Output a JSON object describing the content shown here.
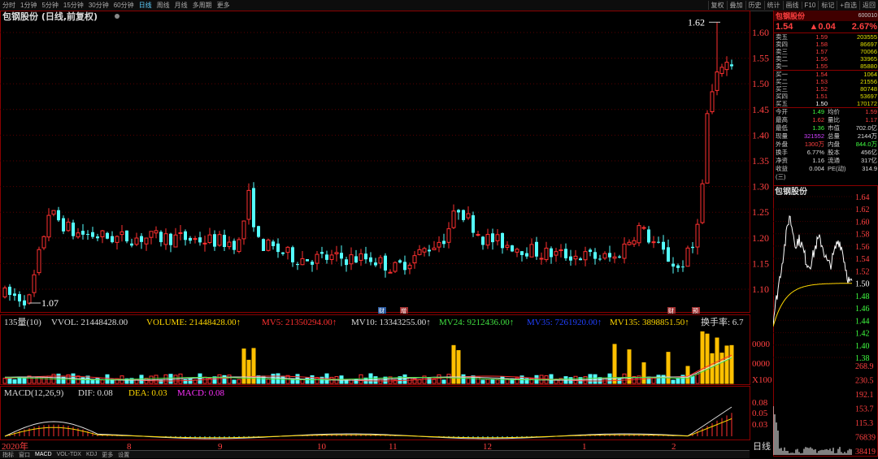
{
  "toolbar": {
    "timeframes": [
      "分时",
      "1分钟",
      "5分钟",
      "15分钟",
      "30分钟",
      "60分钟",
      "日线",
      "周线",
      "月线",
      "多周期",
      "更多"
    ],
    "active_timeframe": "日线",
    "right_buttons": [
      "复权",
      "叠加",
      "历史",
      "统计",
      "画线",
      "F10",
      "标记",
      "+自选",
      "返回"
    ]
  },
  "chart_data": {
    "type": "candlestick",
    "title": "包钢股份 (日线,前复权)",
    "y_ticks": [
      "1.60",
      "1.55",
      "1.50",
      "1.45",
      "1.40",
      "1.35",
      "1.30",
      "1.25",
      "1.20",
      "1.15",
      "1.10"
    ],
    "ylim": [
      1.07,
      1.63
    ],
    "annotation_high": "1.62",
    "annotation_low": "1.07",
    "x_labels": [
      "2020年",
      "8",
      "9",
      "10",
      "11",
      "12",
      "1",
      "2"
    ],
    "vol_legend": [
      {
        "text": "135量(10)",
        "color": "#dddddd"
      },
      {
        "text": "VVOL: 21448428.00",
        "color": "#dddddd"
      },
      {
        "text": "VOLUME: 21448428.00↑",
        "color": "#ffd700"
      },
      {
        "text": "MV5: 21350294.00↑",
        "color": "#ff3030"
      },
      {
        "text": "MV10: 13343255.00↑",
        "color": "#dddddd"
      },
      {
        "text": "MV24: 9212436.00↑",
        "color": "#40e040"
      },
      {
        "text": "MV35: 7261920.00↑",
        "color": "#2040ff"
      },
      {
        "text": "MV135: 3898851.50↑",
        "color": "#ffd700"
      },
      {
        "text": "换手率: 6.7",
        "color": "#dddddd"
      }
    ],
    "vol_ticks": [
      "0000",
      "0000",
      "X100"
    ],
    "macd_legend": [
      {
        "text": "MACD(12,26,9)",
        "color": "#dddddd"
      },
      {
        "text": "DIF: 0.08",
        "color": "#dddddd"
      },
      {
        "text": "DEA: 0.03",
        "color": "#ffd700"
      },
      {
        "text": "MACD: 0.08",
        "color": "#ff30ff"
      }
    ],
    "macd_ticks": [
      "0.08",
      "0.05",
      "0.03"
    ],
    "markers": [
      "财",
      "增",
      "财",
      "预"
    ]
  },
  "bottom_tabs": [
    "指标",
    "窗口",
    "MACD",
    "VOL-TDX",
    "KDJ",
    "更多",
    "设置"
  ],
  "bottom_label": "日线",
  "right_panel": {
    "name": "包钢股份",
    "code": "600010",
    "price": "1.54",
    "change": "▲0.04",
    "pct": "2.67%",
    "sells": [
      {
        "label": "卖五",
        "price": "1.59",
        "vol": "203555"
      },
      {
        "label": "卖四",
        "price": "1.58",
        "vol": "86697"
      },
      {
        "label": "卖三",
        "price": "1.57",
        "vol": "70066"
      },
      {
        "label": "卖二",
        "price": "1.56",
        "vol": "33965"
      },
      {
        "label": "卖一",
        "price": "1.55",
        "vol": "85880"
      }
    ],
    "buys": [
      {
        "label": "买一",
        "price": "1.54",
        "vol": "1064"
      },
      {
        "label": "买二",
        "price": "1.53",
        "vol": "21556"
      },
      {
        "label": "买三",
        "price": "1.52",
        "vol": "80748"
      },
      {
        "label": "买四",
        "price": "1.51",
        "vol": "53697"
      },
      {
        "label": "买五",
        "price": "1.50",
        "vol": "170172"
      }
    ],
    "stats": [
      {
        "l": "今开",
        "v": "1.49",
        "c": "green",
        "l2": "均价",
        "v2": "1.59",
        "c2": "red"
      },
      {
        "l": "最高",
        "v": "1.62",
        "c": "red",
        "l2": "量比",
        "v2": "1.17",
        "c2": "red"
      },
      {
        "l": "最低",
        "v": "1.36",
        "c": "green",
        "l2": "市值",
        "v2": "702.0亿",
        "c2": "white"
      },
      {
        "l": "现量",
        "v": "321552",
        "c": "purple",
        "l2": "总量",
        "v2": "2144万",
        "c2": "white"
      },
      {
        "l": "外盘",
        "v": "1300万",
        "c": "red",
        "l2": "内盘",
        "v2": "844.0万",
        "c2": "green"
      },
      {
        "l": "换手",
        "v": "6.77%",
        "c": "white",
        "l2": "股本",
        "v2": "456亿",
        "c2": "white"
      },
      {
        "l": "净资",
        "v": "1.16",
        "c": "white",
        "l2": "流通",
        "v2": "317亿",
        "c2": "white"
      },
      {
        "l": "收益(三)",
        "v": "0.004",
        "c": "white",
        "l2": "PE(动)",
        "v2": "314.9",
        "c2": "white"
      }
    ]
  },
  "mini_chart": {
    "title": "包钢股份",
    "price_ticks": [
      "1.64",
      "1.62",
      "1.60",
      "1.58",
      "1.56",
      "1.54",
      "1.52",
      "1.50",
      "1.48",
      "1.46",
      "1.44",
      "1.42",
      "1.40",
      "1.38"
    ],
    "vol_ticks": [
      "268.9",
      "230.5",
      "192.1",
      "153.7",
      "115.3",
      "76839",
      "38419"
    ]
  }
}
